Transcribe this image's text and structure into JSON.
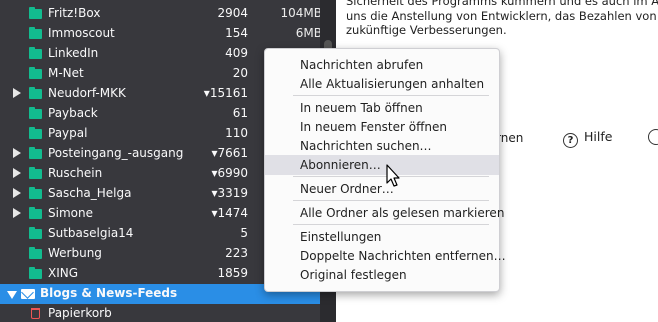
{
  "content": {
    "text_lines": [
      "Sicherheit des Programms kümmern und es auch im A",
      "uns die Anstellung von Entwicklern, das Bezahlen von K",
      "zukünftige Verbesserungen."
    ],
    "link_partial": "rnen",
    "help_label": "Hilfe"
  },
  "sidebar": {
    "folders": [
      {
        "name": "Fritz!Box",
        "unread": "2904",
        "size": "104MB",
        "expandable": false
      },
      {
        "name": "Immoscout",
        "unread": "154",
        "size": "6MB",
        "expandable": false
      },
      {
        "name": "LinkedIn",
        "unread": "409",
        "size": "",
        "expandable": false
      },
      {
        "name": "M-Net",
        "unread": "20",
        "size": "",
        "expandable": false
      },
      {
        "name": "Neudorf-MKK",
        "unread": "▾15161",
        "size": "",
        "expandable": true
      },
      {
        "name": "Payback",
        "unread": "61",
        "size": "",
        "expandable": false
      },
      {
        "name": "Paypal",
        "unread": "110",
        "size": "",
        "expandable": false
      },
      {
        "name": "Posteingang_-ausgang",
        "unread": "▾7661",
        "size": "",
        "expandable": true
      },
      {
        "name": "Ruschein",
        "unread": "▾6990",
        "size": "",
        "expandable": true
      },
      {
        "name": "Sascha_Helga",
        "unread": "▾3319",
        "size": "",
        "expandable": true
      },
      {
        "name": "Simone",
        "unread": "▾1474",
        "size": "",
        "expandable": true
      },
      {
        "name": "Sutbaselgia14",
        "unread": "5",
        "size": "",
        "expandable": false
      },
      {
        "name": "Werbung",
        "unread": "223",
        "size": "",
        "expandable": false
      },
      {
        "name": "XING",
        "unread": "1859",
        "size": "",
        "expandable": false
      }
    ],
    "account": {
      "name": "Blogs & News-Feeds"
    },
    "trash": {
      "name": "Papierkorb"
    }
  },
  "context_menu": {
    "groups": [
      [
        "Nachrichten abrufen",
        "Alle Aktualisierungen anhalten"
      ],
      [
        "In neuem Tab öffnen",
        "In neuem Fenster öffnen",
        "Nachrichten suchen…",
        "Abonnieren…"
      ],
      [
        "Neuer Ordner…"
      ],
      [
        "Alle Ordner als gelesen markieren"
      ],
      [
        "Einstellungen",
        "Doppelte Nachrichten entfernen…",
        "Original festlegen"
      ]
    ],
    "hovered_item": "Abonnieren…"
  },
  "colors": {
    "sidebar_bg": "#38383d",
    "folder_icon": "#12bc8f",
    "selection": "#2a8ee6",
    "menu_bg": "#fbfbfb",
    "menu_hover": "#e0e0e6"
  }
}
